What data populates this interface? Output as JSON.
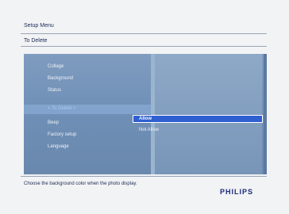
{
  "header": {
    "title": "Setup Menu",
    "subtitle": "To Delete"
  },
  "menu": {
    "items": [
      {
        "label": "Collage"
      },
      {
        "label": "Background"
      },
      {
        "label": "Status"
      },
      {
        "label": "< To Delete >"
      },
      {
        "label": "Beep"
      },
      {
        "label": "Factory setup"
      },
      {
        "label": "Language"
      }
    ],
    "selected": "< To Delete >"
  },
  "submenu": {
    "options": [
      {
        "label": "Allow"
      },
      {
        "label": "Not Allow"
      }
    ],
    "selected": "Allow"
  },
  "footer": {
    "hint": "Choose the background color when the photo display.",
    "brand": "PHILIPS"
  },
  "colors": {
    "panel_blue": "#6f8fb6",
    "highlight_blue": "#2f5fd0",
    "brand_navy": "#1c2a7a"
  }
}
